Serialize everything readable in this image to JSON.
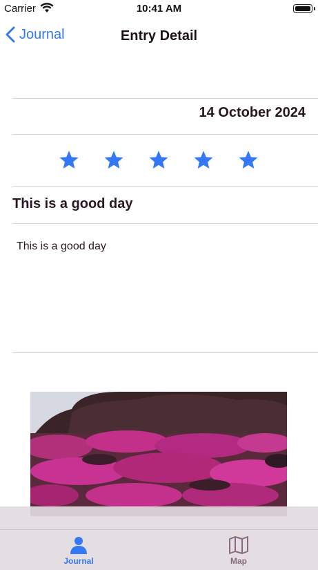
{
  "status_bar": {
    "carrier": "Carrier",
    "time": "10:41 AM"
  },
  "nav": {
    "back_label": "Journal",
    "title": "Entry Detail"
  },
  "entry": {
    "date": "14 October 2024",
    "rating": 5,
    "rating_max": 5,
    "title": "This is a good day",
    "body": "This is a good day"
  },
  "photo": {
    "description_icon": "flowers-photo"
  },
  "tabs": [
    {
      "label": "Journal",
      "icon": "person-icon",
      "active": true
    },
    {
      "label": "Map",
      "icon": "map-icon",
      "active": false
    }
  ],
  "colors": {
    "accent": "#3478f6",
    "text": "#2a1620",
    "tab_inactive": "#8a6a80"
  }
}
